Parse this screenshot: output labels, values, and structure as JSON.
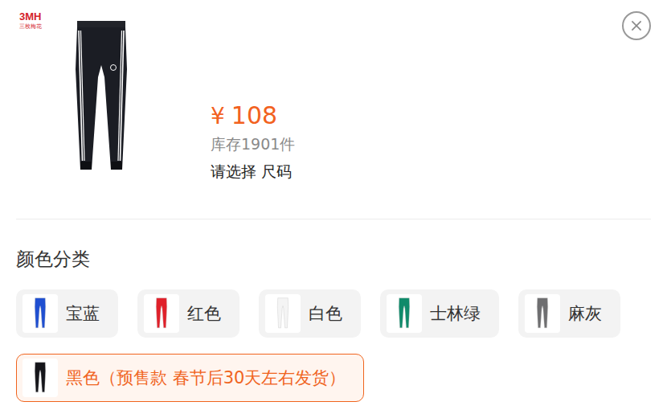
{
  "brand": {
    "logo": "3MH",
    "name": "三枚梅花"
  },
  "product": {
    "currency": "¥",
    "price": "108",
    "stock": "库存1901件",
    "prompt": "请选择 尺码"
  },
  "section": {
    "title": "颜色分类"
  },
  "options": [
    {
      "name": "宝蓝",
      "color": "#1f4fd1",
      "selected": false
    },
    {
      "name": "红色",
      "color": "#e0202a",
      "selected": false
    },
    {
      "name": "白色",
      "color": "#f4f4f4",
      "selected": false
    },
    {
      "name": "士林绿",
      "color": "#0f8a6a",
      "selected": false
    },
    {
      "name": "麻灰",
      "color": "#6e6e70",
      "selected": false
    },
    {
      "name": "黑色（预售款 春节后30天左右发货）",
      "color": "#15151a",
      "selected": true
    }
  ]
}
